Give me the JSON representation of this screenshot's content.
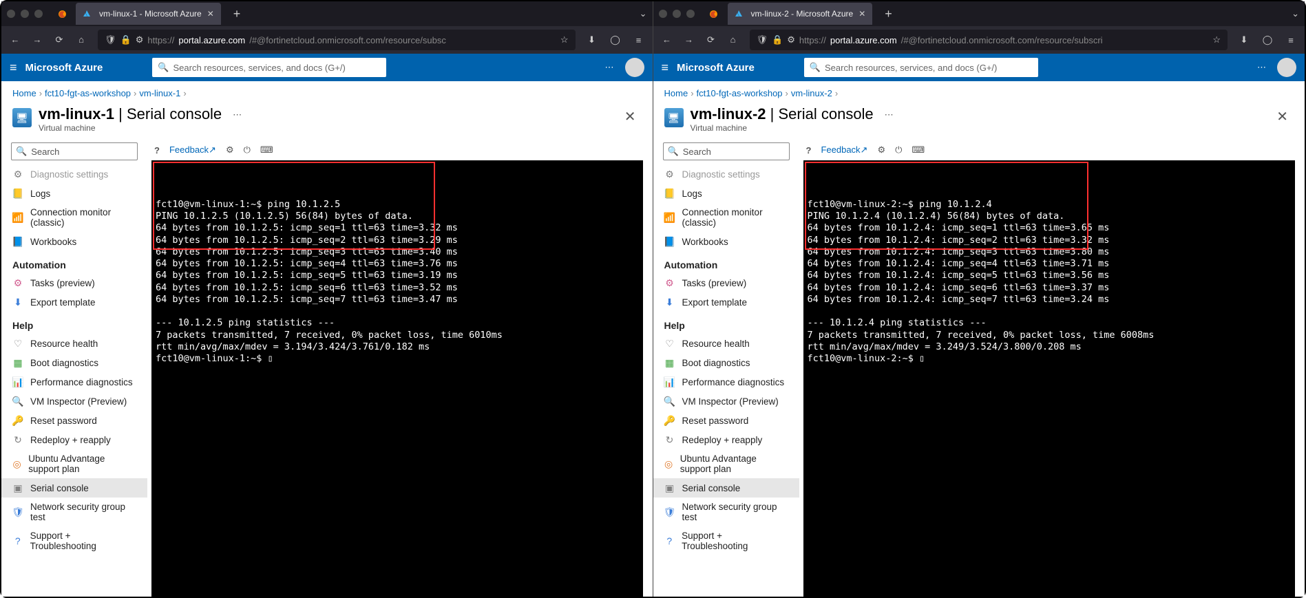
{
  "panes": [
    {
      "tab_title": "vm-linux-1 - Microsoft Azure",
      "url_prefix": "https://",
      "url_host": "portal.azure.com",
      "url_path": "/#@fortinetcloud.onmicrosoft.com/resource/subsc",
      "brand": "Microsoft Azure",
      "az_search_placeholder": "Search resources, services, and docs (G+/)",
      "crumbs": [
        "Home",
        "fct10-fgt-as-workshop",
        "vm-linux-1"
      ],
      "blade_name": "vm-linux-1",
      "blade_sep": " | ",
      "blade_sub": "Serial console",
      "blade_type": "Virtual machine",
      "sidebar_search": "Search",
      "feedback": "Feedback",
      "terminal_lines": [
        "fct10@vm-linux-1:~$ ping 10.1.2.5",
        "PING 10.1.2.5 (10.1.2.5) 56(84) bytes of data.",
        "64 bytes from 10.1.2.5: icmp_seq=1 ttl=63 time=3.32 ms",
        "64 bytes from 10.1.2.5: icmp_seq=2 ttl=63 time=3.29 ms",
        "64 bytes from 10.1.2.5: icmp_seq=3 ttl=63 time=3.40 ms",
        "64 bytes from 10.1.2.5: icmp_seq=4 ttl=63 time=3.76 ms",
        "64 bytes from 10.1.2.5: icmp_seq=5 ttl=63 time=3.19 ms",
        "64 bytes from 10.1.2.5: icmp_seq=6 ttl=63 time=3.52 ms",
        "64 bytes from 10.1.2.5: icmp_seq=7 ttl=63 time=3.47 ms",
        "",
        "--- 10.1.2.5 ping statistics ---",
        "7 packets transmitted, 7 received, 0% packet loss, time 6010ms",
        "rtt min/avg/max/mdev = 3.194/3.424/3.761/0.182 ms",
        "fct10@vm-linux-1:~$ ▯"
      ]
    },
    {
      "tab_title": "vm-linux-2 - Microsoft Azure",
      "url_prefix": "https://",
      "url_host": "portal.azure.com",
      "url_path": "/#@fortinetcloud.onmicrosoft.com/resource/subscri",
      "brand": "Microsoft Azure",
      "az_search_placeholder": "Search resources, services, and docs (G+/)",
      "crumbs": [
        "Home",
        "fct10-fgt-as-workshop",
        "vm-linux-2"
      ],
      "blade_name": "vm-linux-2",
      "blade_sep": " | ",
      "blade_sub": "Serial console",
      "blade_type": "Virtual machine",
      "sidebar_search": "Search",
      "feedback": "Feedback",
      "terminal_lines": [
        "fct10@vm-linux-2:~$ ping 10.1.2.4",
        "PING 10.1.2.4 (10.1.2.4) 56(84) bytes of data.",
        "64 bytes from 10.1.2.4: icmp_seq=1 ttl=63 time=3.65 ms",
        "64 bytes from 10.1.2.4: icmp_seq=2 ttl=63 time=3.32 ms",
        "64 bytes from 10.1.2.4: icmp_seq=3 ttl=63 time=3.80 ms",
        "64 bytes from 10.1.2.4: icmp_seq=4 ttl=63 time=3.71 ms",
        "64 bytes from 10.1.2.4: icmp_seq=5 ttl=63 time=3.56 ms",
        "64 bytes from 10.1.2.4: icmp_seq=6 ttl=63 time=3.37 ms",
        "64 bytes from 10.1.2.4: icmp_seq=7 ttl=63 time=3.24 ms",
        "",
        "--- 10.1.2.4 ping statistics ---",
        "7 packets transmitted, 7 received, 0% packet loss, time 6008ms",
        "rtt min/avg/max/mdev = 3.249/3.524/3.800/0.208 ms",
        "fct10@vm-linux-2:~$ ▯"
      ]
    }
  ],
  "sidebar": {
    "top_fragment": "Diagnostic settings",
    "items_pre_automation": [
      {
        "label": "Logs",
        "icon": "📒",
        "color": "c-blue"
      },
      {
        "label": "Connection monitor (classic)",
        "icon": "📶",
        "color": "c-teal"
      },
      {
        "label": "Workbooks",
        "icon": "📘",
        "color": "c-blue"
      }
    ],
    "automation_header": "Automation",
    "items_automation": [
      {
        "label": "Tasks (preview)",
        "icon": "⚙",
        "color": "c-pink"
      },
      {
        "label": "Export template",
        "icon": "⬇",
        "color": "c-blue"
      }
    ],
    "help_header": "Help",
    "items_help": [
      {
        "label": "Resource health",
        "icon": "♡",
        "color": "c-gray"
      },
      {
        "label": "Boot diagnostics",
        "icon": "▦",
        "color": "c-green"
      },
      {
        "label": "Performance diagnostics",
        "icon": "📊",
        "color": "c-blue"
      },
      {
        "label": "VM Inspector (Preview)",
        "icon": "🔍",
        "color": "c-blue"
      },
      {
        "label": "Reset password",
        "icon": "🔑",
        "color": "c-yellow"
      },
      {
        "label": "Redeploy + reapply",
        "icon": "↻",
        "color": "c-gray"
      },
      {
        "label": "Ubuntu Advantage support plan",
        "icon": "◎",
        "color": "c-orange"
      },
      {
        "label": "Serial console",
        "icon": "▣",
        "color": "c-gray",
        "selected": true
      },
      {
        "label": "Network security group test",
        "icon": "🛡",
        "color": "c-blue"
      },
      {
        "label": "Support + Troubleshooting",
        "icon": "?",
        "color": "c-blue"
      }
    ]
  }
}
